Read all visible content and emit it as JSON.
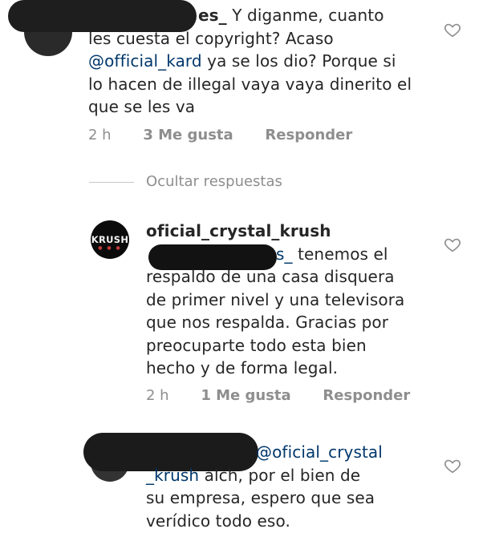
{
  "comments": [
    {
      "username_tail": "es_",
      "text_lines": [
        "Y diganme,  cuanto",
        "les cuesta el copyright?  Acaso"
      ],
      "mention": "@official_kard",
      "after_mention": "  ya se los dio?  Porque si",
      "more_lines": [
        "lo hacen de illegal vaya vaya dinerito el",
        "que se les va"
      ],
      "time": "2 h",
      "likes": "3 Me gusta",
      "reply": "Responder"
    }
  ],
  "thread": {
    "hide_replies": "Ocultar respuestas"
  },
  "reply1": {
    "username": "oficial_crystal_krush",
    "logo_text": "KRUSH",
    "logo_dots": "● ● ●",
    "mention_tail": "s_",
    "first_line_rest": " tenemos el",
    "lines": [
      "respaldo de una casa disquera",
      "de primer nivel y una televisora",
      "que nos respalda. Gracias por",
      "preocuparte todo esta bien",
      "hecho y de forma legal."
    ],
    "time": "2 h",
    "likes": "1 Me gusta",
    "reply": "Responder"
  },
  "reply2": {
    "mention_part1": "@oficial_crystal",
    "mention_part2": "_krush",
    "line2_rest": " alch, por el bien de",
    "lines": [
      "su empresa, espero que sea",
      "verídico todo eso."
    ]
  }
}
